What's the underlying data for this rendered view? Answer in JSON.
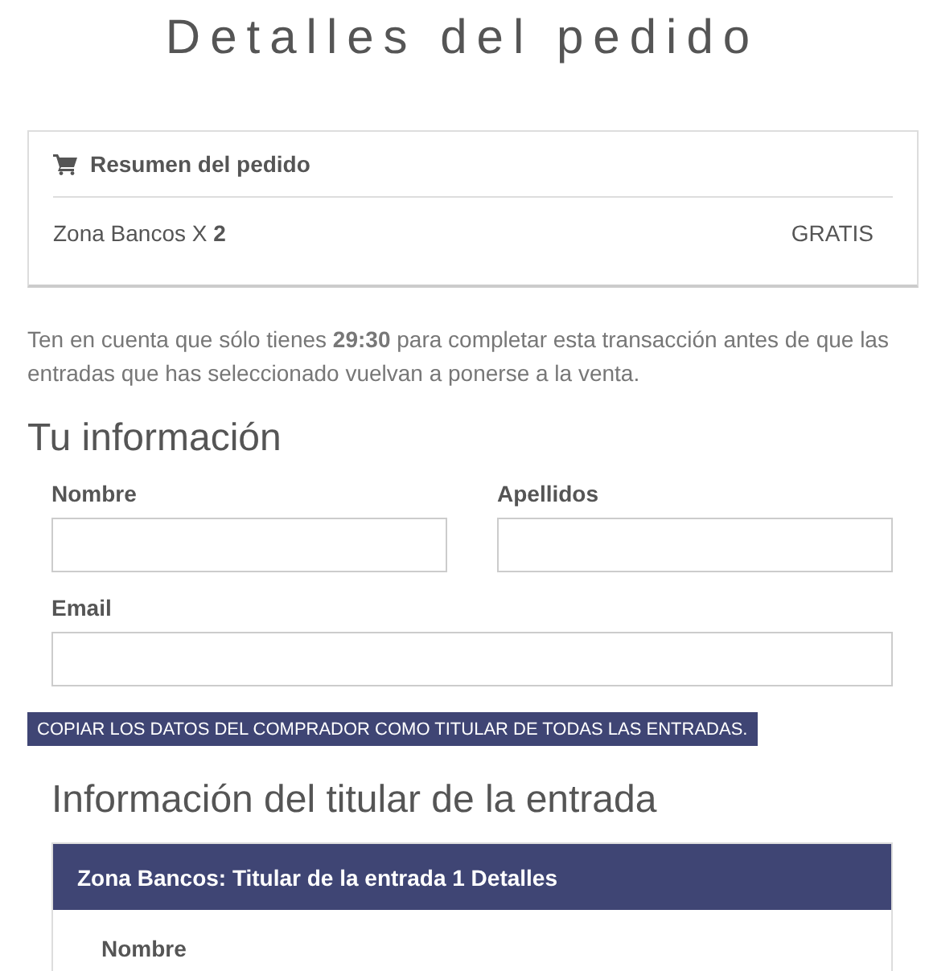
{
  "page_title": "Detalles del pedido",
  "order_summary": {
    "title": "Resumen del pedido",
    "items": [
      {
        "name": "Zona Bancos X **2**",
        "price": "GRATIS"
      }
    ]
  },
  "notice": "Ten en cuenta que sólo tienes **29:30** para completar esta transacción antes de que las entradas que has seleccionado vuelvan a ponerse a la venta.",
  "buyer_section": {
    "title": "Tu información",
    "fields": [
      {
        "label": "Nombre",
        "kind": "half"
      },
      {
        "label": "Apellidos",
        "kind": "half"
      },
      {
        "label": "Email",
        "kind": "full"
      }
    ]
  },
  "copy_button": "COPIAR LOS DATOS DEL COMPRADOR COMO TITULAR DE TODAS LAS ENTRADAS.",
  "holder_section": {
    "title": "Información del titular de la entrada",
    "panel_title": "Zona Bancos: Titular de la entrada 1 Detalles",
    "fields": [
      {
        "label": "Nombre"
      }
    ]
  }
}
